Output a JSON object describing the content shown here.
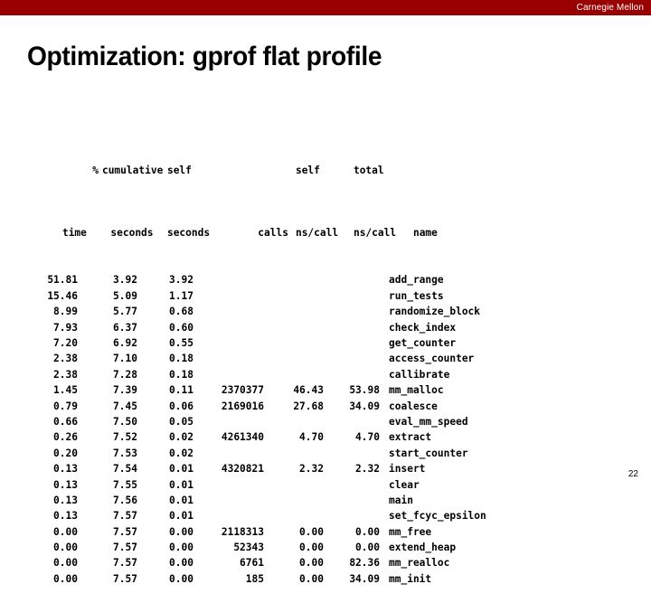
{
  "banner": {
    "institution": "Carnegie Mellon",
    "color": "#990000"
  },
  "slide": {
    "title": "Optimization: gprof flat profile",
    "page_number": "22"
  },
  "profile_table": {
    "header_line_1": {
      "pct": "%",
      "cumulative": "cumulative",
      "self_seconds": "self",
      "calls": "",
      "self_ns_call": "self",
      "total_ns_call": "total",
      "name": ""
    },
    "header_line_2": {
      "pct": "time",
      "cumulative": "seconds",
      "self_seconds": "seconds",
      "calls": "calls",
      "self_ns_call": "ns/call",
      "total_ns_call": "ns/call",
      "name": "name"
    },
    "rows": [
      {
        "pct": "51.81",
        "cumulative": "3.92",
        "self_seconds": "3.92",
        "calls": "",
        "self_ns_call": "",
        "total_ns_call": "",
        "name": "add_range"
      },
      {
        "pct": "15.46",
        "cumulative": "5.09",
        "self_seconds": "1.17",
        "calls": "",
        "self_ns_call": "",
        "total_ns_call": "",
        "name": "run_tests"
      },
      {
        "pct": "8.99",
        "cumulative": "5.77",
        "self_seconds": "0.68",
        "calls": "",
        "self_ns_call": "",
        "total_ns_call": "",
        "name": "randomize_block"
      },
      {
        "pct": "7.93",
        "cumulative": "6.37",
        "self_seconds": "0.60",
        "calls": "",
        "self_ns_call": "",
        "total_ns_call": "",
        "name": "check_index"
      },
      {
        "pct": "7.20",
        "cumulative": "6.92",
        "self_seconds": "0.55",
        "calls": "",
        "self_ns_call": "",
        "total_ns_call": "",
        "name": "get_counter"
      },
      {
        "pct": "2.38",
        "cumulative": "7.10",
        "self_seconds": "0.18",
        "calls": "",
        "self_ns_call": "",
        "total_ns_call": "",
        "name": "access_counter"
      },
      {
        "pct": "2.38",
        "cumulative": "7.28",
        "self_seconds": "0.18",
        "calls": "",
        "self_ns_call": "",
        "total_ns_call": "",
        "name": "callibrate"
      },
      {
        "pct": "1.45",
        "cumulative": "7.39",
        "self_seconds": "0.11",
        "calls": "2370377",
        "self_ns_call": "46.43",
        "total_ns_call": "53.98",
        "name": "mm_malloc"
      },
      {
        "pct": "0.79",
        "cumulative": "7.45",
        "self_seconds": "0.06",
        "calls": "2169016",
        "self_ns_call": "27.68",
        "total_ns_call": "34.09",
        "name": "coalesce"
      },
      {
        "pct": "0.66",
        "cumulative": "7.50",
        "self_seconds": "0.05",
        "calls": "",
        "self_ns_call": "",
        "total_ns_call": "",
        "name": "eval_mm_speed"
      },
      {
        "pct": "0.26",
        "cumulative": "7.52",
        "self_seconds": "0.02",
        "calls": "4261340",
        "self_ns_call": "4.70",
        "total_ns_call": "4.70",
        "name": "extract"
      },
      {
        "pct": "0.20",
        "cumulative": "7.53",
        "self_seconds": "0.02",
        "calls": "",
        "self_ns_call": "",
        "total_ns_call": "",
        "name": "start_counter"
      },
      {
        "pct": "0.13",
        "cumulative": "7.54",
        "self_seconds": "0.01",
        "calls": "4320821",
        "self_ns_call": "2.32",
        "total_ns_call": "2.32",
        "name": "insert"
      },
      {
        "pct": "0.13",
        "cumulative": "7.55",
        "self_seconds": "0.01",
        "calls": "",
        "self_ns_call": "",
        "total_ns_call": "",
        "name": "clear"
      },
      {
        "pct": "0.13",
        "cumulative": "7.56",
        "self_seconds": "0.01",
        "calls": "",
        "self_ns_call": "",
        "total_ns_call": "",
        "name": "main"
      },
      {
        "pct": "0.13",
        "cumulative": "7.57",
        "self_seconds": "0.01",
        "calls": "",
        "self_ns_call": "",
        "total_ns_call": "",
        "name": "set_fcyc_epsilon"
      },
      {
        "pct": "0.00",
        "cumulative": "7.57",
        "self_seconds": "0.00",
        "calls": "2118313",
        "self_ns_call": "0.00",
        "total_ns_call": "0.00",
        "name": "mm_free"
      },
      {
        "pct": "0.00",
        "cumulative": "7.57",
        "self_seconds": "0.00",
        "calls": "52343",
        "self_ns_call": "0.00",
        "total_ns_call": "0.00",
        "name": "extend_heap"
      },
      {
        "pct": "0.00",
        "cumulative": "7.57",
        "self_seconds": "0.00",
        "calls": "6761",
        "self_ns_call": "0.00",
        "total_ns_call": "82.36",
        "name": "mm_realloc"
      },
      {
        "pct": "0.00",
        "cumulative": "7.57",
        "self_seconds": "0.00",
        "calls": "185",
        "self_ns_call": "0.00",
        "total_ns_call": "34.09",
        "name": "mm_init"
      }
    ]
  }
}
